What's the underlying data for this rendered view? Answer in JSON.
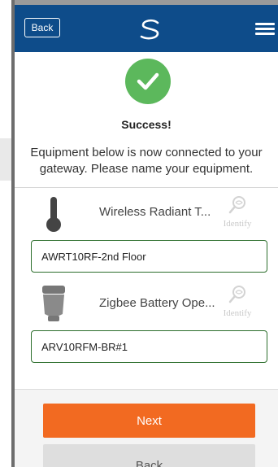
{
  "header": {
    "back_label": "Back",
    "colors": {
      "bar": "#0e4c8a",
      "accent": "#f26a21",
      "success": "#5cb85c"
    }
  },
  "status": {
    "title": "Success!",
    "message": "Equipment below is now connected to your gateway. Please name your equipment."
  },
  "equipment": [
    {
      "name": "Wireless Radiant T...",
      "identify_label": "Identify",
      "icon": "thermometer-icon",
      "input_value": "AWRT10RF-2nd Floor"
    },
    {
      "name": "Zigbee Battery Ope...",
      "identify_label": "Identify",
      "icon": "battery-valve-icon",
      "input_value": "ARV10RFM-BR#1"
    }
  ],
  "footer": {
    "next_label": "Next",
    "back_label": "Back"
  }
}
